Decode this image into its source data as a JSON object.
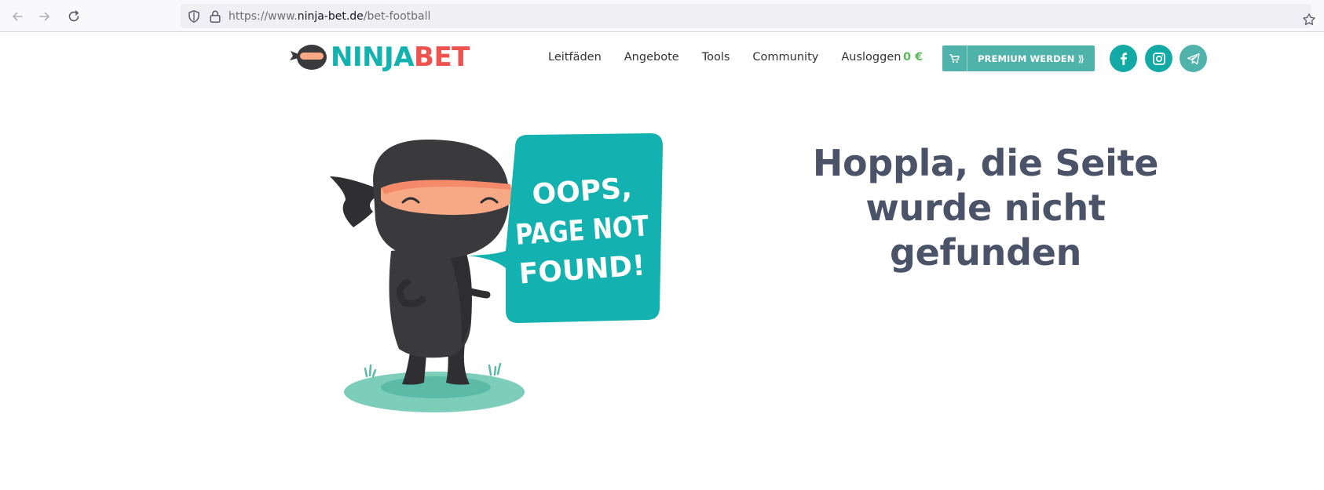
{
  "browser": {
    "url_prefix": "https://www.",
    "url_host": "ninja-bet.de",
    "url_path": "/bet-football"
  },
  "header": {
    "logo_part1": "NINJA",
    "logo_part2": "BET",
    "nav": [
      {
        "label": "Leitfäden"
      },
      {
        "label": "Angebote"
      },
      {
        "label": "Tools"
      },
      {
        "label": "Community"
      },
      {
        "label": "Ausloggen"
      }
    ],
    "balance": "0 €",
    "premium_label": "PREMIUM WERDEN ⟫",
    "social": [
      "facebook-icon",
      "instagram-icon",
      "telegram-icon"
    ]
  },
  "main": {
    "bubble_lines": [
      "OOPS,",
      "PAGE NOT",
      "FOUND!"
    ],
    "headline_lines": [
      "Hoppla, die Seite",
      "wurde nicht",
      "gefunden"
    ]
  },
  "colors": {
    "teal": "#13b1b0",
    "coral": "#ef5350",
    "green": "#5cb85c",
    "button": "#4fb3ac",
    "headline": "#4a5368"
  }
}
